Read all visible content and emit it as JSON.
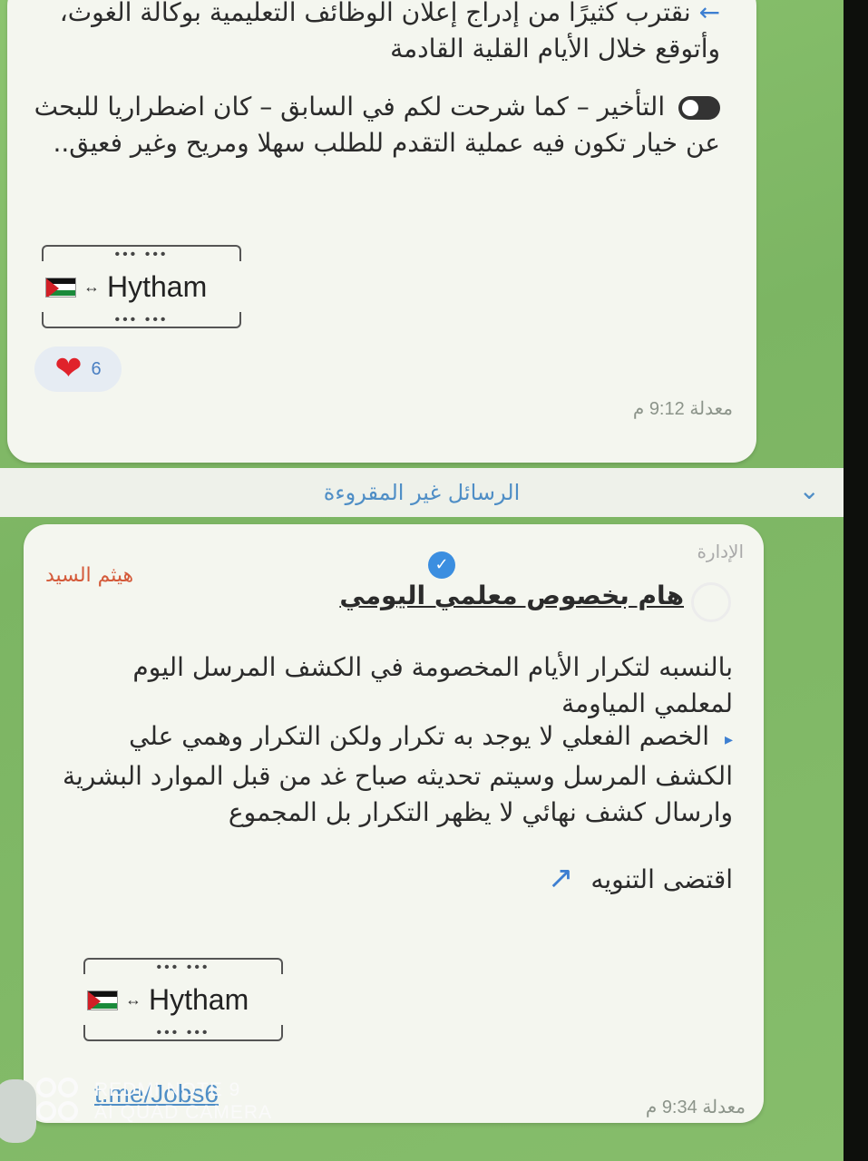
{
  "message1": {
    "line_a_arrow": "←",
    "line_a": "نقترب كثيرًا من إدراج إعلان الوظائف التعليمية بوكالة الغوث، وأتوقع خلال الأيام القلية القادمة",
    "paragraph_b": "التأخير – كما شرحت لكم في السابق – كان اضطراريا للبحث عن خيار تكون فيه عملية التقدم للطلب سهلا ومريح وغير فعيق..",
    "signature_name": "Hytham",
    "signature_dots": "•••  •••",
    "reaction_count": "6",
    "edited_label": "معدلة",
    "time": "9:12 م"
  },
  "unread_banner": {
    "label": "الرسائل غير المقروءة"
  },
  "message2": {
    "sender": "هيثم السيد",
    "admin_tag": "الإدارة",
    "title": "هام بخصوص معلمي اليومي",
    "paragraph_1": "بالنسبه لتكرار الأيام المخصومة في الكشف المرسل اليوم لمعلمي المياومة",
    "paragraph_2": "الخصم الفعلي لا يوجد به تكرار ولكن التكرار وهمي علي الكشف المرسل وسيتم تحديثه صباح غد من قبل الموارد البشرية وارسال كشف نهائي لا يظهر التكرار بل المجموع",
    "paragraph_3": "اقتضى التنويه",
    "signature_name": "Hytham",
    "signature_dots": "•••  •••",
    "link": "t.me/Jobs6",
    "edited_label": "معدلة",
    "time": "9:34 م"
  },
  "camera_watermark": {
    "line1": "REDMI NOTE 9",
    "line2": "AI QUAD CAMERA"
  },
  "colors": {
    "chat_background": "#7fb46a",
    "bubble": "#f4f6ef",
    "accent_blue": "#3d7fd1",
    "sender_name": "#d45a3a",
    "heart": "#e0222b"
  }
}
